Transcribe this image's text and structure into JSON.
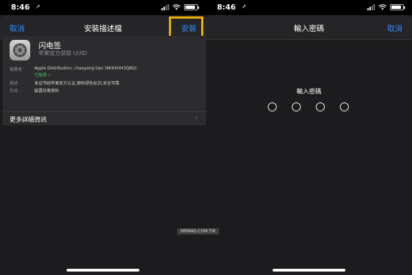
{
  "left_screen": {
    "status": {
      "time": "8:46",
      "location_glyph": "➚"
    },
    "nav": {
      "cancel": "取消",
      "title": "安裝描述檔",
      "install": "安裝"
    },
    "profile": {
      "name": "闪电签",
      "subtitle": "苹果官方获取 UUID",
      "signed_by_label": "簽署者",
      "signed_by_value": "Apple Distribution: chaoyang tian (8K6XHH3Q8Q)",
      "verified": "已驗證 ✓",
      "description_label": "描述",
      "description_value": "本证书经苹果官方认证,拥有绿色标识,安全可靠",
      "contains_label": "包含",
      "contains_value": "裝置註冊資料"
    },
    "more_details": "更多詳細資訊",
    "chevron": "›"
  },
  "right_screen": {
    "status": {
      "time": "8:46",
      "location_glyph": "➚"
    },
    "nav": {
      "title": "輸入密碼",
      "cancel": "取消"
    },
    "passcode_prompt": "輸入密碼",
    "passcode_length": 4
  },
  "watermark": "MRMAD.COM.TW",
  "colors": {
    "accent": "#2f8cff",
    "highlight": "#f2b400",
    "verified": "#34c759"
  },
  "status_bar": {
    "signal_bars_active": 2,
    "signal_bars_total": 4,
    "battery_level": 0.85
  }
}
